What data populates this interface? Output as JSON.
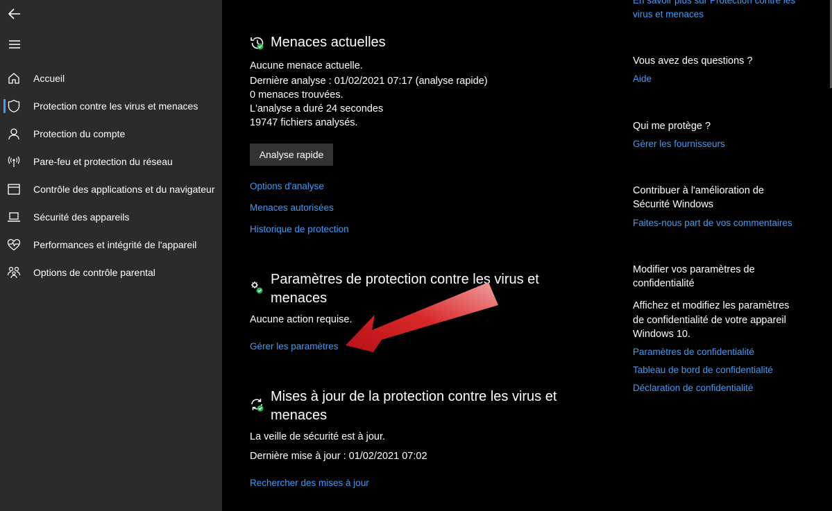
{
  "sidebar": {
    "back_icon": "back-arrow-icon",
    "menu_icon": "hamburger-menu-icon",
    "items": [
      {
        "label": "Accueil",
        "icon": "home-icon"
      },
      {
        "label": "Protection contre les virus et menaces",
        "icon": "shield-icon",
        "active": true
      },
      {
        "label": "Protection du compte",
        "icon": "person-icon"
      },
      {
        "label": "Pare-feu et protection du réseau",
        "icon": "wireless-icon"
      },
      {
        "label": "Contrôle des applications et du navigateur",
        "icon": "browser-window-icon"
      },
      {
        "label": "Sécurité des appareils",
        "icon": "laptop-icon"
      },
      {
        "label": "Performances et intégrité de l'appareil",
        "icon": "heart-pulse-icon"
      },
      {
        "label": "Options de contrôle parental",
        "icon": "family-icon"
      }
    ],
    "accent": "#3aa0ff"
  },
  "threats": {
    "title": "Menaces actuelles",
    "lines": [
      "Aucune menace actuelle.",
      "Dernière analyse : 01/02/2021 07:17 (analyse rapide)",
      "0 menaces trouvées.",
      "L'analyse a duré 24 secondes",
      "19747 fichiers analysés."
    ],
    "quick_scan": "Analyse rapide",
    "links": [
      "Options d'analyse",
      "Menaces autorisées",
      "Historique de protection"
    ]
  },
  "settings": {
    "title": "Paramètres de protection contre les virus et menaces",
    "status": "Aucune action requise.",
    "link": "Gérer les paramètres"
  },
  "updates": {
    "title": "Mises à jour de la protection contre les virus et menaces",
    "status": "La veille de sécurité est à jour.",
    "last_update": "Dernière mise à jour : 01/02/2021 07:02",
    "link": "Rechercher des mises à jour"
  },
  "right": {
    "top_link": "En savoir plus sur Protection contre les virus et menaces",
    "questions_head": "Vous avez des questions ?",
    "questions_link": "Aide",
    "protects_head": "Qui me protège ?",
    "protects_link": "Gérer les fournisseurs",
    "improve_head": "Contribuer à l'amélioration de Sécurité Windows",
    "improve_link": "Faites-nous part de vos commentaires",
    "privacy_head": "Modifier vos paramètres de confidentialité",
    "privacy_text": "Affichez et modifiez les paramètres de confidentialité de votre appareil Windows 10.",
    "privacy_links": [
      "Paramètres de confidentialité",
      "Tableau de bord de confidentialité",
      "Déclaration de confidentialité"
    ]
  },
  "colors": {
    "link": "#3f9cf7",
    "sidebar_bg": "#2b2b2b",
    "ok_green": "#2bb24c",
    "annotation_arrow": "#d0151c"
  }
}
